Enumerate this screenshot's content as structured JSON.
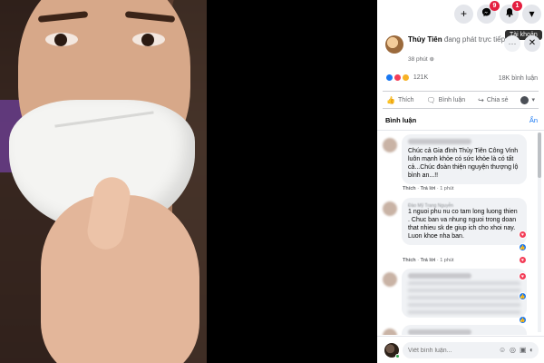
{
  "topbar": {
    "create_icon": "+",
    "messenger_badge": "9",
    "notifications_badge": "1",
    "account_icon": "▾",
    "tooltip": "Tài khoản"
  },
  "post": {
    "author": "Thủy Tiên",
    "status": "đang phát trực tiếp",
    "time": "38 phút",
    "privacy_icon": "globe-icon",
    "reaction_count": "121K",
    "comment_count": "18K bình luận",
    "reaction_colors": [
      "#1877f2",
      "#f33e58",
      "#f7b125"
    ]
  },
  "actions": {
    "like": "Thích",
    "comment": "Bình luận",
    "share": "Chia sẻ"
  },
  "comments_section": {
    "title": "Bình luận",
    "hide": "Ẩn",
    "items": [
      {
        "text": "Chúc cả Gia đình Thủy Tiên Công Vinh luôn mạnh khỏe có sức khỏe là có tất cả...Chúc đoàn thiện nguyện thượng lộ bình an...!!",
        "like": "Thích",
        "reply": "Trả lời",
        "time": "1 phút"
      },
      {
        "name": "Đào Mỹ Trang Nguyễn",
        "text": "1 nguoi phu nu co tam long luong thien . Chuc ban va nhung nguoi trong doan that nhieu sk de giup ich cho xhoi nay. Luon khoe nha ban.",
        "like": "Thích",
        "reply": "Trả lời",
        "time": "1 phút"
      }
    ]
  },
  "composer": {
    "placeholder": "Viết bình luận..."
  }
}
